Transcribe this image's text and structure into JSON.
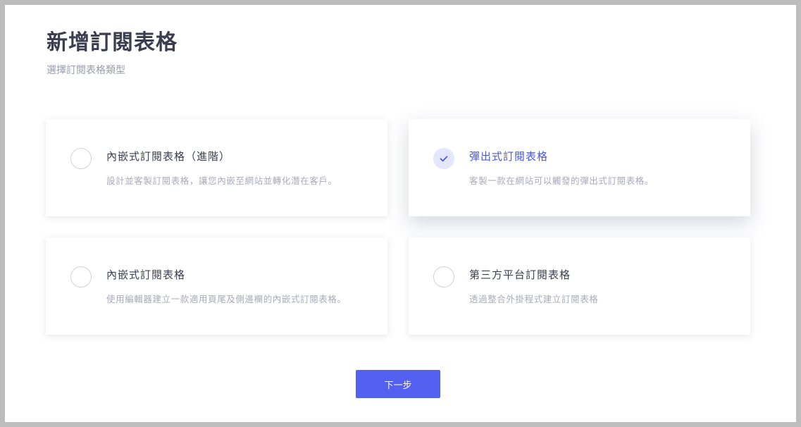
{
  "header": {
    "title": "新增訂閱表格",
    "subtitle": "選擇訂閱表格類型"
  },
  "options": [
    {
      "title": "內嵌式訂閱表格（進階）",
      "desc": "設計並客製訂閱表格，讓您內嵌至網站並轉化潛在客戶。",
      "selected": false
    },
    {
      "title": "彈出式訂閱表格",
      "desc": "客製一款在網站可以觸發的彈出式訂閱表格。",
      "selected": true
    },
    {
      "title": "內嵌式訂閱表格",
      "desc": "使用編輯器建立一款適用頁尾及側邊欄的內嵌式訂閱表格。",
      "selected": false
    },
    {
      "title": "第三方平台訂閱表格",
      "desc": "透過整合外掛程式建立訂閱表格",
      "selected": false
    }
  ],
  "footer": {
    "next_label": "下一步"
  },
  "colors": {
    "accent": "#5460f0",
    "selected_title": "#4a58e8",
    "radio_checked_bg": "#e4e6fb"
  }
}
